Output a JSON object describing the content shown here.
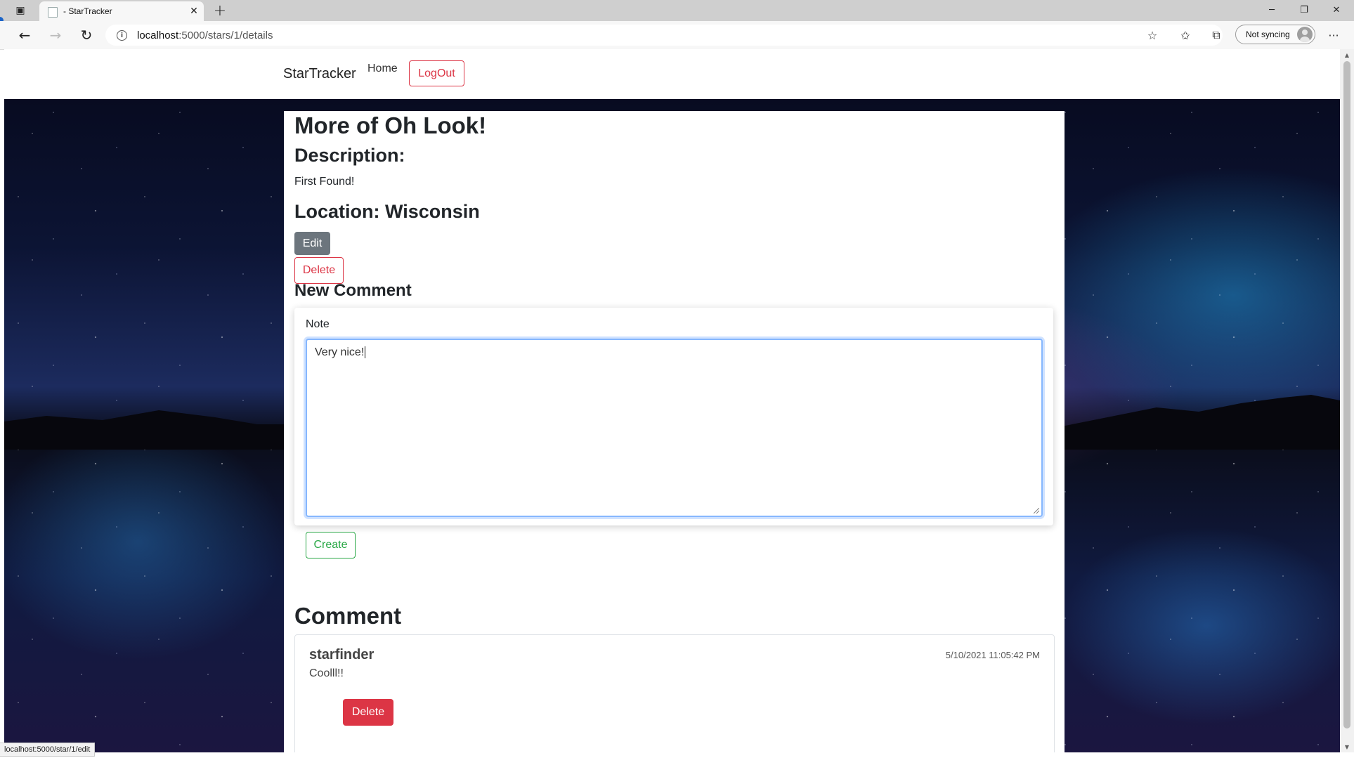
{
  "browser": {
    "tab_title": "- StarTracker",
    "tab_actions_icon": "tab-actions-icon",
    "new_tab_symbol": "+",
    "window_controls": {
      "minimize": "─",
      "restore": "❐",
      "close": "✕"
    },
    "url_host": "localhost",
    "url_rest": ":5000/stars/1/details",
    "profile_label": "Not syncing",
    "status_url": "localhost:5000/star/1/edit",
    "icons": {
      "back": "←",
      "forward": "→",
      "refresh": "↻",
      "info": "i",
      "add_favorite": "☆",
      "favorites": "✩",
      "collections": "⧉",
      "more": "···"
    }
  },
  "navbar": {
    "brand": "StarTracker",
    "home_link": "Home",
    "logout_button": "LogOut"
  },
  "star": {
    "title": "More of Oh Look!",
    "description_heading": "Description:",
    "description": "First Found!",
    "location_heading": "Location: Wisconsin",
    "edit_button": "Edit",
    "delete_button": "Delete"
  },
  "new_comment": {
    "heading": "New Comment",
    "note_label": "Note",
    "note_value": "Very nice!",
    "create_button": "Create"
  },
  "comments": {
    "heading": "Comment",
    "items": [
      {
        "author": "starfinder",
        "timestamp": "5/10/2021 11:05:42 PM",
        "text": "Coolll!!",
        "delete_button": "Delete"
      }
    ]
  },
  "colors": {
    "danger": "#dc3545",
    "success": "#28a745",
    "secondary": "#6c757d",
    "focus_border": "#86b7fe"
  }
}
